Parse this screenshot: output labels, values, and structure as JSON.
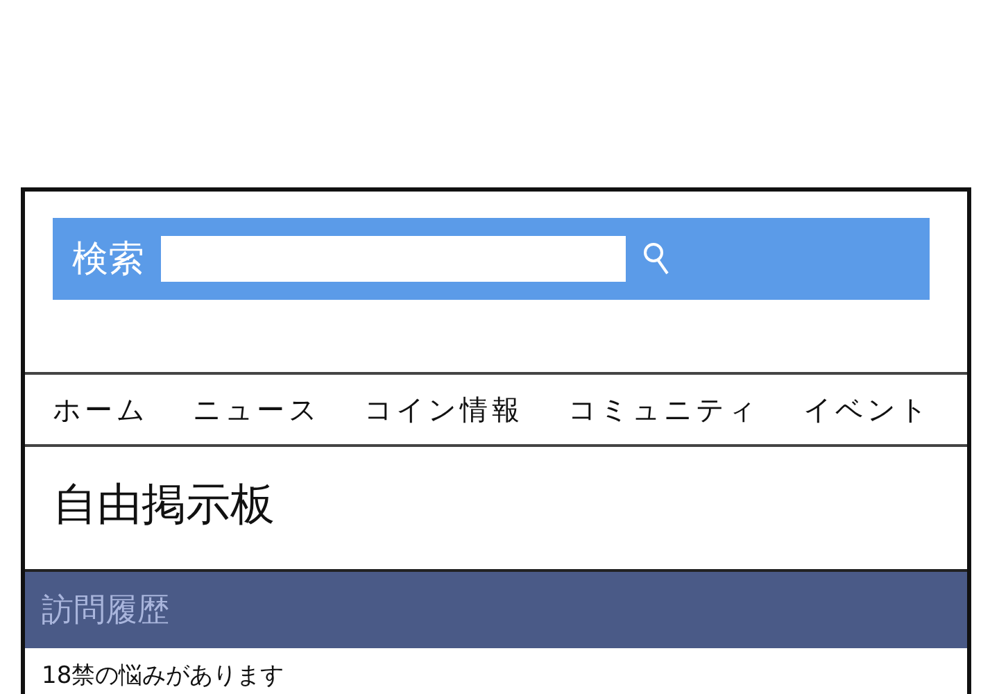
{
  "search": {
    "label": "検索"
  },
  "nav": {
    "items": [
      {
        "label": "ホーム"
      },
      {
        "label": "ニュース"
      },
      {
        "label": "コイン情報"
      },
      {
        "label": "コミュニティ"
      },
      {
        "label": "イベント"
      }
    ]
  },
  "page_title": "自由掲示板",
  "history": {
    "heading": "訪問履歴",
    "items": [
      "18禁の悩みがあります"
    ]
  }
}
